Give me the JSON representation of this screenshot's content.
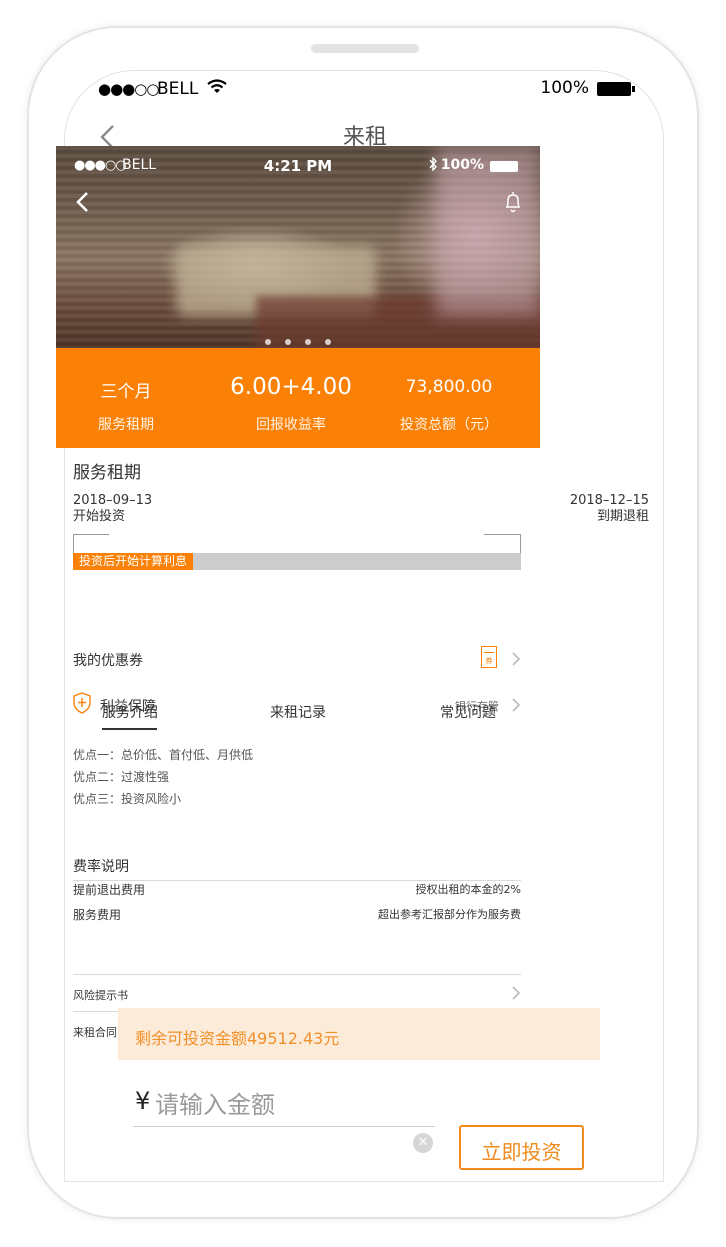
{
  "status_bar": {
    "signal": "●●●○○",
    "carrier": "BELL",
    "battery": "100%"
  },
  "nav": {
    "title": "来租"
  },
  "hero": {
    "status": {
      "signal": "●●●○○",
      "carrier": "BELL",
      "time": "4:21 PM",
      "battery": "100%"
    },
    "dots_count": 4
  },
  "stats": [
    {
      "value": "三个月",
      "label": "服务租期"
    },
    {
      "value": "6.00+4.00",
      "label": "回报收益率"
    },
    {
      "value": "73,800.00",
      "label": "投资总额（元）"
    }
  ],
  "term": {
    "title": "服务租期",
    "start_date": "2018–09–13",
    "start_label": "开始投资",
    "end_date": "2018–12–15",
    "end_label": "到期退租",
    "progress_label": "投资后开始计算利息"
  },
  "coupon": {
    "label": "我的优惠券",
    "icon_text": "券"
  },
  "rights": {
    "label": "利益保障",
    "value": "银行存管"
  },
  "tabs": [
    {
      "label": "服务介绍",
      "active": true
    },
    {
      "label": "来租记录",
      "active": false
    },
    {
      "label": "常见问题",
      "active": false
    }
  ],
  "pros": [
    "优点一：总价低、首付低、月供低",
    "优点二：过渡性强",
    "优点三：投资风险小"
  ],
  "fees": {
    "title": "费率说明",
    "rows": [
      {
        "key": "提前退出费用",
        "value": "授权出租的本金的2%"
      },
      {
        "key": "服务费用",
        "value": "超出参考汇报部分作为服务费"
      }
    ]
  },
  "links": [
    "风险提示书",
    "来租合同"
  ],
  "remaining": "剩余可投资金额49512.43元",
  "amount_input": {
    "currency": "¥",
    "placeholder": "请输入金额"
  },
  "invest_button": "立即投资",
  "colors": {
    "accent": "#fb8006",
    "remain_bg": "#fdebd9"
  }
}
